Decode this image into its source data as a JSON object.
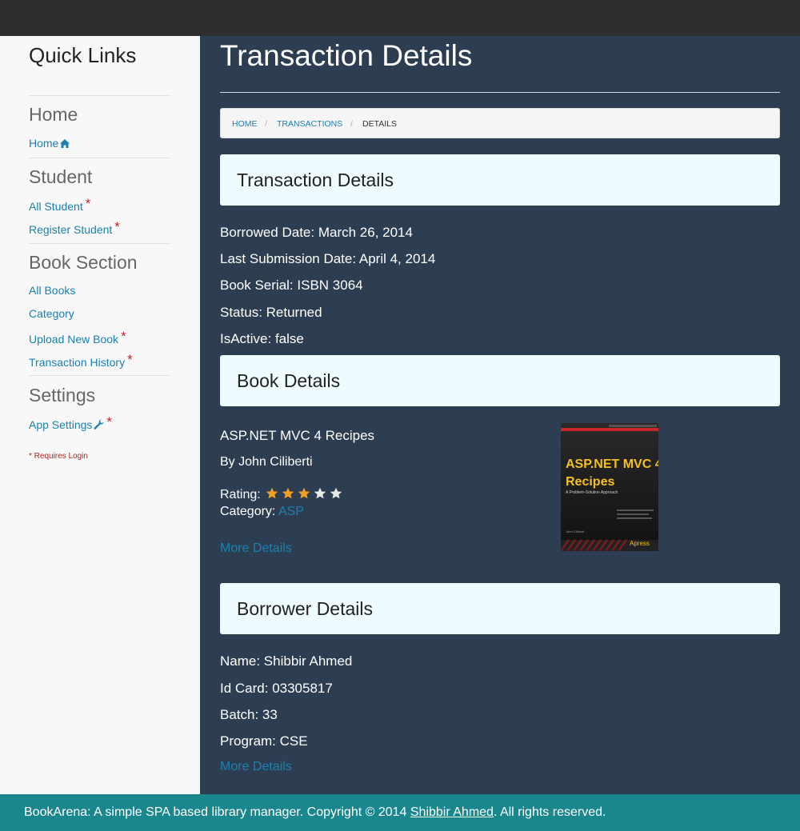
{
  "sidebar": {
    "title": "Quick Links",
    "sections": [
      {
        "heading": "Home",
        "links": [
          "Home"
        ]
      },
      {
        "heading": "Student",
        "links": [
          "All Student",
          "Register Student"
        ]
      },
      {
        "heading": "Book Section",
        "links": [
          "All Books",
          "Category",
          "Upload New Book",
          "Transaction History"
        ]
      },
      {
        "heading": "Settings",
        "links": [
          "App Settings"
        ]
      }
    ],
    "requires_login": "* Requires Login"
  },
  "page": {
    "title": "Transaction Details"
  },
  "breadcrumb": {
    "home": "HOME",
    "transactions": "TRANSACTIONS",
    "current": "DETAILS",
    "separator": "/"
  },
  "transaction": {
    "heading": "Transaction Details",
    "borrowed_date": "Borrowed Date: March 26, 2014",
    "last_submission_date": "Last Submission Date: April 4, 2014",
    "book_serial": "Book Serial: ISBN 3064",
    "status": "Status: Returned",
    "is_active": "IsActive: false"
  },
  "book": {
    "heading": "Book Details",
    "title": "ASP.NET MVC 4 Recipes",
    "author": "By John Ciliberti",
    "rating_label": "Rating:",
    "rating": 3,
    "rating_max": 5,
    "category_label": "Category:",
    "category": "ASP",
    "more": "More Details",
    "cover": {
      "title_line1": "ASP.NET MVC 4",
      "title_line2": "Recipes",
      "subtitle": "A Problem-Solution Approach",
      "author": "John Ciliberti",
      "publisher": "Apress"
    }
  },
  "borrower": {
    "heading": "Borrower Details",
    "name": "Name: Shibbir Ahmed",
    "id_card": "Id Card: 03305817",
    "batch": "Batch: 33",
    "program": "Program: CSE",
    "more": "More Details"
  },
  "footer": {
    "text_before": "BookArena: A simple SPA based library manager. Copyright © 2014 ",
    "author_link": "Shibbir Ahmed",
    "text_after": ". All rights reserved."
  },
  "colors": {
    "main_bg": "#2e3e52",
    "topbar": "#2e2e2e",
    "sidebar_bg": "#f8f8f8",
    "link": "#1a80b0",
    "panel_head": "#eefbff",
    "footer": "#1a878e",
    "star_filled": "#f0a020",
    "star_empty": "#e8e8e8",
    "required": "#c0262c"
  }
}
